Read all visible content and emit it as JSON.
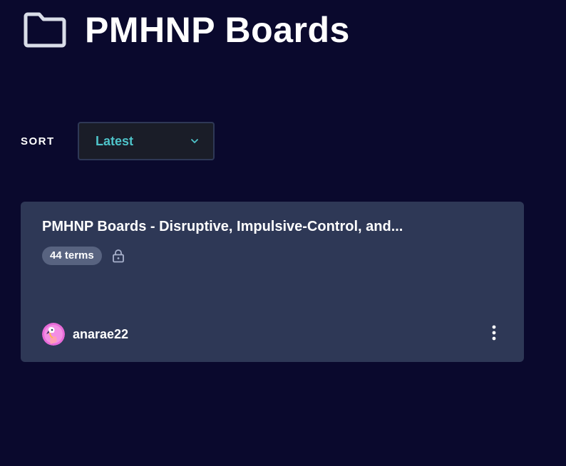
{
  "header": {
    "title": "PMHNP Boards",
    "icon": "folder-icon"
  },
  "sort": {
    "label": "SORT",
    "selected": "Latest",
    "icon": "chevron-down-icon",
    "accent_color": "#4ec3c9"
  },
  "sets": [
    {
      "title": "PMHNP Boards - Disruptive, Impulsive-Control, and...",
      "terms": "44 terms",
      "lock_icon": "lock-icon",
      "author": "anarae22",
      "avatar": "flamingo-avatar",
      "menu_icon": "more-vertical-icon"
    }
  ],
  "colors": {
    "background": "#0a092d",
    "card": "#2e3856",
    "badge": "#586380"
  }
}
